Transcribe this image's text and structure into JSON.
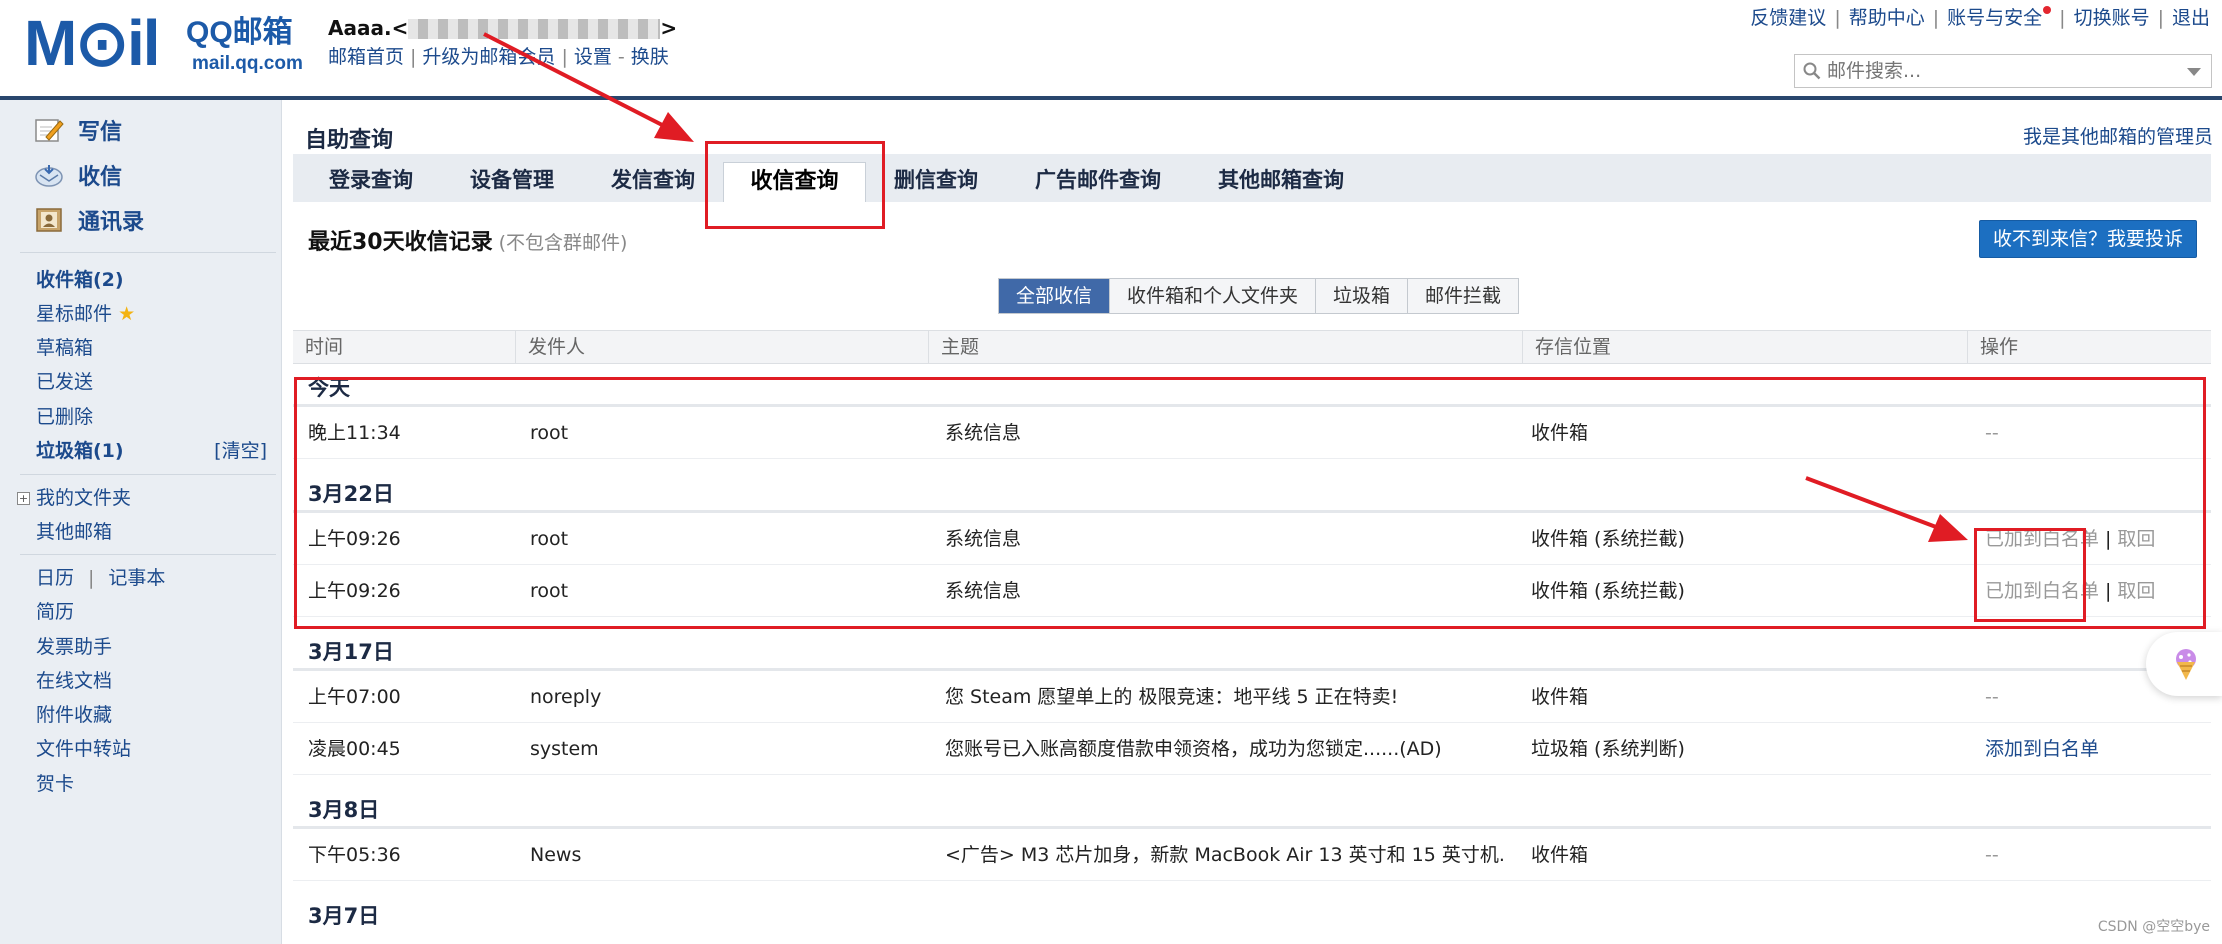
{
  "logo": {
    "big": "M⊙il",
    "qq": "QQ邮箱",
    "url": "mail.qq.com"
  },
  "user": {
    "name_prefix": "Aaaa.<",
    "name_suffix": ">"
  },
  "user_links": [
    "邮箱首页",
    "升级为邮箱会员",
    "设置",
    "换肤"
  ],
  "top_links": [
    "反馈建议",
    "帮助中心",
    "账号与安全",
    "切换账号",
    "退出"
  ],
  "search": {
    "placeholder": "邮件搜索..."
  },
  "sidebar": {
    "compose": "写信",
    "receive": "收信",
    "contacts": "通讯录",
    "inbox": "收件箱(2)",
    "starred": "星标邮件",
    "drafts": "草稿箱",
    "sent": "已发送",
    "deleted": "已删除",
    "junk": "垃圾箱(1)",
    "junk_clear": "[清空]",
    "my_folders": "我的文件夹",
    "other_mailbox": "其他邮箱",
    "calendar": "日历",
    "notebook": "记事本",
    "resume": "简历",
    "invoice": "发票助手",
    "docs": "在线文档",
    "attachments": "附件收藏",
    "transfer": "文件中转站",
    "cards": "贺卡"
  },
  "main": {
    "title": "自助查询",
    "admin_link": "我是其他邮箱的管理员",
    "tabs": [
      "登录查询",
      "设备管理",
      "发信查询",
      "收信查询",
      "删信查询",
      "广告邮件查询",
      "其他邮箱查询"
    ],
    "record_title": "最近30天收信记录",
    "record_note": "(不包含群邮件)",
    "complain_button": "收不到来信？我要投诉",
    "filters": [
      "全部收信",
      "收件箱和个人文件夹",
      "垃圾箱",
      "邮件拦截"
    ],
    "columns": [
      "时间",
      "发件人",
      "主题",
      "存信位置",
      "操作"
    ],
    "groups": [
      {
        "date": "今天",
        "rows": [
          {
            "time": "晚上11:34",
            "sender": "root",
            "subject": "系统信息",
            "location": "收件箱",
            "action": "--"
          }
        ]
      },
      {
        "date": "3月22日",
        "rows": [
          {
            "time": "上午09:26",
            "sender": "root",
            "subject": "系统信息",
            "location": "收件箱 (系统拦截)",
            "action_a": "已加到白名单",
            "action_b": "取回"
          },
          {
            "time": "上午09:26",
            "sender": "root",
            "subject": "系统信息",
            "location": "收件箱 (系统拦截)",
            "action_a": "已加到白名单",
            "action_b": "取回"
          }
        ]
      },
      {
        "date": "3月17日",
        "rows": [
          {
            "time": "上午07:00",
            "sender": "noreply",
            "subject": "您 Steam 愿望单上的 极限竞速：地平线 5 正在特卖!",
            "location": "收件箱",
            "action": "--"
          },
          {
            "time": "凌晨00:45",
            "sender": "system",
            "subject": "您账号已入账高额度借款申领资格，成功为您锁定......(AD)",
            "location": "垃圾箱 (系统判断)",
            "action": "添加到白名单"
          }
        ]
      },
      {
        "date": "3月8日",
        "rows": [
          {
            "time": "下午05:36",
            "sender": "News",
            "subject": "<广告> M3 芯片加身，新款 MacBook Air 13 英寸和 15 英寸机...",
            "location": "收件箱",
            "action": "--"
          }
        ]
      },
      {
        "date": "3月7日",
        "rows": []
      }
    ]
  },
  "watermark": "CSDN @空空bye",
  "colors": {
    "brand": "#1c5aa8",
    "link": "#1c4a8c",
    "header_bar": "#29466d",
    "annotation": "#e01c24",
    "button": "#1c6fc1"
  }
}
